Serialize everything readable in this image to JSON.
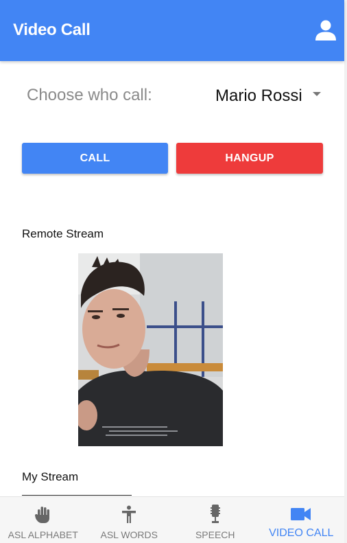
{
  "appbar": {
    "title": "Video Call",
    "account_icon": "account-icon",
    "color": "#4285f4"
  },
  "chooser": {
    "label": "Choose who call:",
    "selected": "Mario Rossi"
  },
  "actions": {
    "call_label": "CALL",
    "hangup_label": "HANGUP",
    "call_color": "#4285f4",
    "hangup_color": "#ee3b3b"
  },
  "streams": {
    "remote_label": "Remote Stream",
    "my_label": "My Stream"
  },
  "bottom_nav": {
    "active": "VIDEO CALL",
    "items": [
      {
        "label": "ASL ALPHABET",
        "icon": "hand-icon"
      },
      {
        "label": "ASL WORDS",
        "icon": "person-icon"
      },
      {
        "label": "SPEECH",
        "icon": "microphone-icon"
      },
      {
        "label": "VIDEO CALL",
        "icon": "videocam-icon"
      }
    ]
  }
}
